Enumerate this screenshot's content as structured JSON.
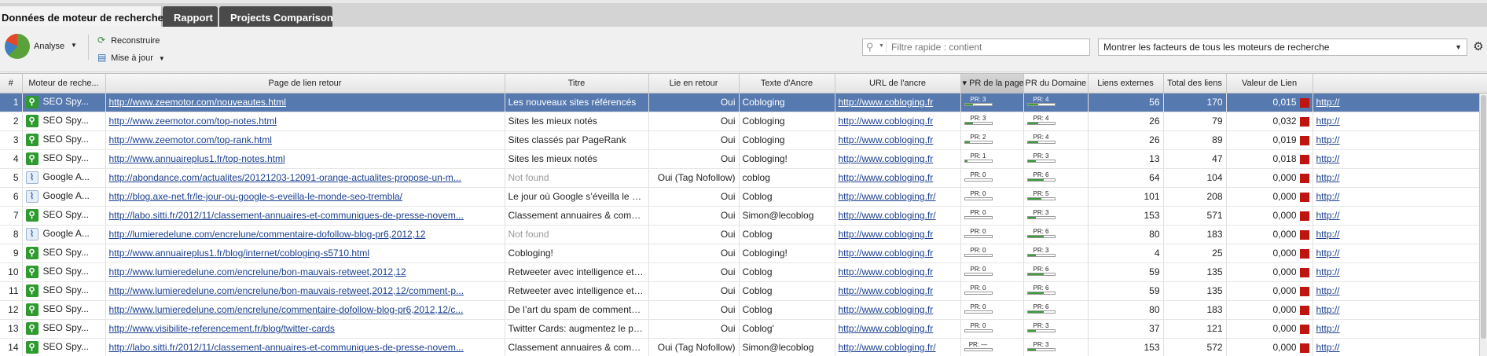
{
  "tabs": [
    {
      "label": "Données de moteur de recherche"
    },
    {
      "label": "Rapport"
    },
    {
      "label": "Projects Comparison"
    }
  ],
  "toolbar": {
    "analyse_label": "Analyse",
    "reconstruire_label": "Reconstruire",
    "update_label": "Mise à jour",
    "search_placeholder": "Filtre rapide : contient",
    "factors_select": "Montrer les facteurs de tous les moteurs de recherche"
  },
  "columns": {
    "idx": "#",
    "engine": "Moteur de reche...",
    "page": "Page de lien retour",
    "title": "Titre",
    "backlink": "Lie en retour",
    "anchor": "Texte d'Ancre",
    "anchor_url": "URL de l'ancre",
    "pr_page": "▾ PR de la page",
    "pr_domain": "PR du Domaine",
    "ext_links": "Liens externes",
    "total_links": "Total des liens",
    "link_value": "Valeur de Lien"
  },
  "rows": [
    {
      "idx": "1",
      "engine": "SEO Spy...",
      "eng": "seo",
      "page": "http://www.zeemotor.com/nouveautes.html",
      "title": "Les nouveaux sites référencés",
      "title_muted": false,
      "backlink": "Oui",
      "anchor": "Cobloging",
      "anchor_url": "http://www.cobloging.fr",
      "pr_page": "PR: 3",
      "pr_page_v": 3,
      "pr_dom": "PR: 4",
      "pr_dom_v": 4,
      "ext": "56",
      "total": "170",
      "value": "0,015",
      "trail": "http://"
    },
    {
      "idx": "2",
      "engine": "SEO Spy...",
      "eng": "seo",
      "page": "http://www.zeemotor.com/top-notes.html",
      "title": "Sites les mieux notés",
      "title_muted": false,
      "backlink": "Oui",
      "anchor": "Cobloging",
      "anchor_url": "http://www.cobloging.fr",
      "pr_page": "PR: 3",
      "pr_page_v": 3,
      "pr_dom": "PR: 4",
      "pr_dom_v": 4,
      "ext": "26",
      "total": "79",
      "value": "0,032",
      "trail": "http://"
    },
    {
      "idx": "3",
      "engine": "SEO Spy...",
      "eng": "seo",
      "page": "http://www.zeemotor.com/top-rank.html",
      "title": "Sites classés par PageRank",
      "title_muted": false,
      "backlink": "Oui",
      "anchor": "Cobloging",
      "anchor_url": "http://www.cobloging.fr",
      "pr_page": "PR: 2",
      "pr_page_v": 2,
      "pr_dom": "PR: 4",
      "pr_dom_v": 4,
      "ext": "26",
      "total": "89",
      "value": "0,019",
      "trail": "http://"
    },
    {
      "idx": "4",
      "engine": "SEO Spy...",
      "eng": "seo",
      "page": "http://www.annuaireplus1.fr/top-notes.html",
      "title": "Sites les mieux notés",
      "title_muted": false,
      "backlink": "Oui",
      "anchor": "Cobloging!",
      "anchor_url": "http://www.cobloging.fr",
      "pr_page": "PR: 1",
      "pr_page_v": 1,
      "pr_dom": "PR: 3",
      "pr_dom_v": 3,
      "ext": "13",
      "total": "47",
      "value": "0,018",
      "trail": "http://"
    },
    {
      "idx": "5",
      "engine": "Google A...",
      "eng": "goog",
      "page": "http://abondance.com/actualites/20121203-12091-orange-actualites-propose-un-m...",
      "title": "Not found",
      "title_muted": true,
      "backlink": "Oui (Tag Nofollow)",
      "anchor": "coblog",
      "anchor_url": "http://www.cobloging.fr",
      "pr_page": "PR: 0",
      "pr_page_v": 0,
      "pr_dom": "PR: 6",
      "pr_dom_v": 6,
      "ext": "64",
      "total": "104",
      "value": "0,000",
      "trail": "http://"
    },
    {
      "idx": "6",
      "engine": "Google A...",
      "eng": "goog",
      "page": "http://blog.axe-net.fr/le-jour-ou-google-s-eveilla-le-monde-seo-trembla/",
      "title": "Le jour où Google s’éveilla le monde...",
      "title_muted": false,
      "backlink": "Oui",
      "anchor": "Coblog",
      "anchor_url": "http://www.cobloging.fr/",
      "pr_page": "PR: 0",
      "pr_page_v": 0,
      "pr_dom": "PR: 5",
      "pr_dom_v": 5,
      "ext": "101",
      "total": "208",
      "value": "0,000",
      "trail": "http://"
    },
    {
      "idx": "7",
      "engine": "SEO Spy...",
      "eng": "seo",
      "page": "http://labo.sitti.fr/2012/11/classement-annuaires-et-communiques-de-presse-novem...",
      "title": "Classement annuaires & communiq...",
      "title_muted": false,
      "backlink": "Oui",
      "anchor": "Simon@lecoblog",
      "anchor_url": "http://www.cobloging.fr/",
      "pr_page": "PR: 0",
      "pr_page_v": 0,
      "pr_dom": "PR: 3",
      "pr_dom_v": 3,
      "ext": "153",
      "total": "571",
      "value": "0,000",
      "trail": "http://"
    },
    {
      "idx": "8",
      "engine": "Google A...",
      "eng": "goog",
      "page": "http://lumieredelune.com/encrelune/commentaire-dofollow-blog-pr6,2012,12",
      "title": "Not found",
      "title_muted": true,
      "backlink": "Oui",
      "anchor": "Coblog",
      "anchor_url": "http://www.cobloging.fr",
      "pr_page": "PR: 0",
      "pr_page_v": 0,
      "pr_dom": "PR: 6",
      "pr_dom_v": 6,
      "ext": "80",
      "total": "183",
      "value": "0,000",
      "trail": "http://"
    },
    {
      "idx": "9",
      "engine": "SEO Spy...",
      "eng": "seo",
      "page": "http://www.annuaireplus1.fr/blog/internet/cobloging-s5710.html",
      "title": "Cobloging!",
      "title_muted": false,
      "backlink": "Oui",
      "anchor": "Cobloging!",
      "anchor_url": "http://www.cobloging.fr",
      "pr_page": "PR: 0",
      "pr_page_v": 0,
      "pr_dom": "PR: 3",
      "pr_dom_v": 3,
      "ext": "4",
      "total": "25",
      "value": "0,000",
      "trail": "http://"
    },
    {
      "idx": "10",
      "engine": "SEO Spy...",
      "eng": "seo",
      "page": "http://www.lumieredelune.com/encrelune/bon-mauvais-retweet,2012,12",
      "title": "Retweeter avec intelligence et effica...",
      "title_muted": false,
      "backlink": "Oui",
      "anchor": "Coblog",
      "anchor_url": "http://www.cobloging.fr",
      "pr_page": "PR: 0",
      "pr_page_v": 0,
      "pr_dom": "PR: 6",
      "pr_dom_v": 6,
      "ext": "59",
      "total": "135",
      "value": "0,000",
      "trail": "http://"
    },
    {
      "idx": "11",
      "engine": "SEO Spy...",
      "eng": "seo",
      "page": "http://www.lumieredelune.com/encrelune/bon-mauvais-retweet,2012,12/comment-p...",
      "title": "Retweeter avec intelligence et effica...",
      "title_muted": false,
      "backlink": "Oui",
      "anchor": "Coblog",
      "anchor_url": "http://www.cobloging.fr",
      "pr_page": "PR: 0",
      "pr_page_v": 0,
      "pr_dom": "PR: 6",
      "pr_dom_v": 6,
      "ext": "59",
      "total": "135",
      "value": "0,000",
      "trail": "http://"
    },
    {
      "idx": "12",
      "engine": "SEO Spy...",
      "eng": "seo",
      "page": "http://www.lumieredelune.com/encrelune/commentaire-dofollow-blog-pr6,2012,12/c...",
      "title": "De l’art du spam de commentaire | ...",
      "title_muted": false,
      "backlink": "Oui",
      "anchor": "Coblog",
      "anchor_url": "http://www.cobloging.fr",
      "pr_page": "PR: 0",
      "pr_page_v": 0,
      "pr_dom": "PR: 6",
      "pr_dom_v": 6,
      "ext": "80",
      "total": "183",
      "value": "0,000",
      "trail": "http://"
    },
    {
      "idx": "13",
      "engine": "SEO Spy...",
      "eng": "seo",
      "page": "http://www.visibilite-referencement.fr/blog/twitter-cards",
      "title": "Twitter Cards: augmentez le pouvoir ...",
      "title_muted": false,
      "backlink": "Oui",
      "anchor": "Coblog'",
      "anchor_url": "http://www.cobloging.fr",
      "pr_page": "PR: 0",
      "pr_page_v": 0,
      "pr_dom": "PR: 3",
      "pr_dom_v": 3,
      "ext": "37",
      "total": "121",
      "value": "0,000",
      "trail": "http://"
    },
    {
      "idx": "14",
      "engine": "SEO Spy...",
      "eng": "seo",
      "page": "http://labo.sitti.fr/2012/11/classement-annuaires-et-communiques-de-presse-novem...",
      "title": "Classement annuaires & communiq...",
      "title_muted": false,
      "backlink": "Oui (Tag Nofollow)",
      "anchor": "Simon@lecoblog",
      "anchor_url": "http://www.cobloging.fr/",
      "pr_page": "PR: —",
      "pr_page_v": 0,
      "pr_dom": "PR: 3",
      "pr_dom_v": 3,
      "ext": "153",
      "total": "572",
      "value": "0,000",
      "trail": "http://"
    }
  ]
}
